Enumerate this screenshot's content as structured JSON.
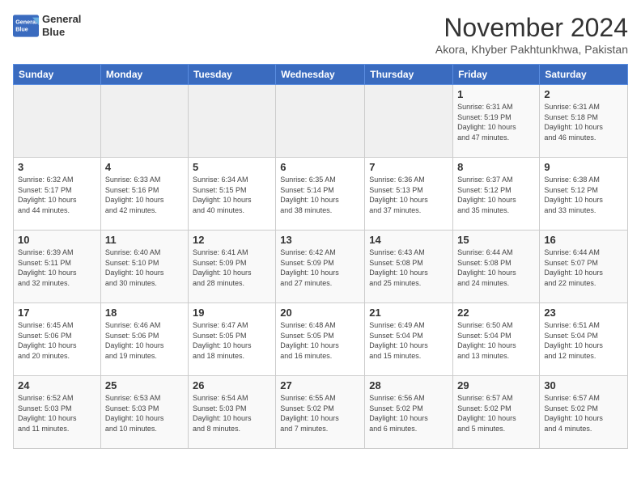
{
  "header": {
    "logo": {
      "line1": "General",
      "line2": "Blue"
    },
    "month": "November 2024",
    "location": "Akora, Khyber Pakhtunkhwa, Pakistan"
  },
  "weekdays": [
    "Sunday",
    "Monday",
    "Tuesday",
    "Wednesday",
    "Thursday",
    "Friday",
    "Saturday"
  ],
  "weeks": [
    [
      {
        "day": "",
        "info": ""
      },
      {
        "day": "",
        "info": ""
      },
      {
        "day": "",
        "info": ""
      },
      {
        "day": "",
        "info": ""
      },
      {
        "day": "",
        "info": ""
      },
      {
        "day": "1",
        "info": "Sunrise: 6:31 AM\nSunset: 5:19 PM\nDaylight: 10 hours\nand 47 minutes."
      },
      {
        "day": "2",
        "info": "Sunrise: 6:31 AM\nSunset: 5:18 PM\nDaylight: 10 hours\nand 46 minutes."
      }
    ],
    [
      {
        "day": "3",
        "info": "Sunrise: 6:32 AM\nSunset: 5:17 PM\nDaylight: 10 hours\nand 44 minutes."
      },
      {
        "day": "4",
        "info": "Sunrise: 6:33 AM\nSunset: 5:16 PM\nDaylight: 10 hours\nand 42 minutes."
      },
      {
        "day": "5",
        "info": "Sunrise: 6:34 AM\nSunset: 5:15 PM\nDaylight: 10 hours\nand 40 minutes."
      },
      {
        "day": "6",
        "info": "Sunrise: 6:35 AM\nSunset: 5:14 PM\nDaylight: 10 hours\nand 38 minutes."
      },
      {
        "day": "7",
        "info": "Sunrise: 6:36 AM\nSunset: 5:13 PM\nDaylight: 10 hours\nand 37 minutes."
      },
      {
        "day": "8",
        "info": "Sunrise: 6:37 AM\nSunset: 5:12 PM\nDaylight: 10 hours\nand 35 minutes."
      },
      {
        "day": "9",
        "info": "Sunrise: 6:38 AM\nSunset: 5:12 PM\nDaylight: 10 hours\nand 33 minutes."
      }
    ],
    [
      {
        "day": "10",
        "info": "Sunrise: 6:39 AM\nSunset: 5:11 PM\nDaylight: 10 hours\nand 32 minutes."
      },
      {
        "day": "11",
        "info": "Sunrise: 6:40 AM\nSunset: 5:10 PM\nDaylight: 10 hours\nand 30 minutes."
      },
      {
        "day": "12",
        "info": "Sunrise: 6:41 AM\nSunset: 5:09 PM\nDaylight: 10 hours\nand 28 minutes."
      },
      {
        "day": "13",
        "info": "Sunrise: 6:42 AM\nSunset: 5:09 PM\nDaylight: 10 hours\nand 27 minutes."
      },
      {
        "day": "14",
        "info": "Sunrise: 6:43 AM\nSunset: 5:08 PM\nDaylight: 10 hours\nand 25 minutes."
      },
      {
        "day": "15",
        "info": "Sunrise: 6:44 AM\nSunset: 5:08 PM\nDaylight: 10 hours\nand 24 minutes."
      },
      {
        "day": "16",
        "info": "Sunrise: 6:44 AM\nSunset: 5:07 PM\nDaylight: 10 hours\nand 22 minutes."
      }
    ],
    [
      {
        "day": "17",
        "info": "Sunrise: 6:45 AM\nSunset: 5:06 PM\nDaylight: 10 hours\nand 20 minutes."
      },
      {
        "day": "18",
        "info": "Sunrise: 6:46 AM\nSunset: 5:06 PM\nDaylight: 10 hours\nand 19 minutes."
      },
      {
        "day": "19",
        "info": "Sunrise: 6:47 AM\nSunset: 5:05 PM\nDaylight: 10 hours\nand 18 minutes."
      },
      {
        "day": "20",
        "info": "Sunrise: 6:48 AM\nSunset: 5:05 PM\nDaylight: 10 hours\nand 16 minutes."
      },
      {
        "day": "21",
        "info": "Sunrise: 6:49 AM\nSunset: 5:04 PM\nDaylight: 10 hours\nand 15 minutes."
      },
      {
        "day": "22",
        "info": "Sunrise: 6:50 AM\nSunset: 5:04 PM\nDaylight: 10 hours\nand 13 minutes."
      },
      {
        "day": "23",
        "info": "Sunrise: 6:51 AM\nSunset: 5:04 PM\nDaylight: 10 hours\nand 12 minutes."
      }
    ],
    [
      {
        "day": "24",
        "info": "Sunrise: 6:52 AM\nSunset: 5:03 PM\nDaylight: 10 hours\nand 11 minutes."
      },
      {
        "day": "25",
        "info": "Sunrise: 6:53 AM\nSunset: 5:03 PM\nDaylight: 10 hours\nand 10 minutes."
      },
      {
        "day": "26",
        "info": "Sunrise: 6:54 AM\nSunset: 5:03 PM\nDaylight: 10 hours\nand 8 minutes."
      },
      {
        "day": "27",
        "info": "Sunrise: 6:55 AM\nSunset: 5:02 PM\nDaylight: 10 hours\nand 7 minutes."
      },
      {
        "day": "28",
        "info": "Sunrise: 6:56 AM\nSunset: 5:02 PM\nDaylight: 10 hours\nand 6 minutes."
      },
      {
        "day": "29",
        "info": "Sunrise: 6:57 AM\nSunset: 5:02 PM\nDaylight: 10 hours\nand 5 minutes."
      },
      {
        "day": "30",
        "info": "Sunrise: 6:57 AM\nSunset: 5:02 PM\nDaylight: 10 hours\nand 4 minutes."
      }
    ]
  ]
}
